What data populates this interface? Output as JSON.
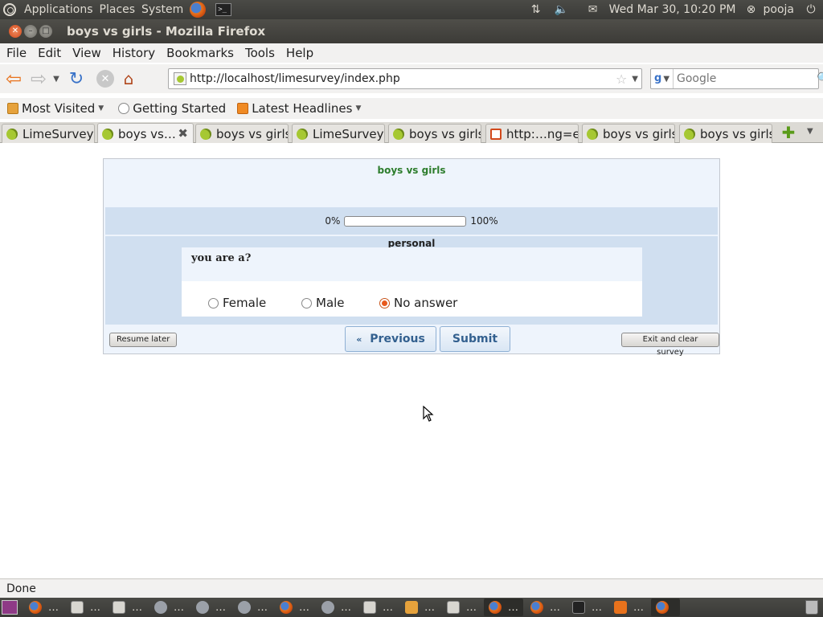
{
  "top_panel": {
    "applications": "Applications",
    "places": "Places",
    "system": "System",
    "datetime": "Wed Mar 30, 10:20 PM",
    "user": "pooja"
  },
  "window": {
    "title": "boys vs girls - Mozilla Firefox"
  },
  "menu": {
    "items": [
      "File",
      "Edit",
      "View",
      "History",
      "Bookmarks",
      "Tools",
      "Help"
    ]
  },
  "navbar": {
    "url": "http://localhost/limesurvey/index.php",
    "search_placeholder": "Google"
  },
  "bookmarks": {
    "items": [
      "Most Visited",
      "Getting Started",
      "Latest Headlines"
    ]
  },
  "tabs": [
    {
      "label": "LimeSurvey"
    },
    {
      "label": "boys vs…",
      "active": true
    },
    {
      "label": "boys vs girls"
    },
    {
      "label": "LimeSurvey"
    },
    {
      "label": "boys vs girls"
    },
    {
      "label": "http:…ng=en"
    },
    {
      "label": "boys vs girls"
    },
    {
      "label": "boys vs girls"
    }
  ],
  "survey": {
    "title": "boys vs girls",
    "progress_start": "0%",
    "progress_end": "100%",
    "progress_value": 0,
    "group_name": "personal",
    "question": "you are a?",
    "answers": [
      "Female",
      "Male",
      "No answer"
    ],
    "selected_answer": "No answer",
    "resume_later": "Resume later",
    "previous": "Previous",
    "previous_icon": "«",
    "submit": "Submit",
    "exit_clear": "Exit and clear survey"
  },
  "status": {
    "text": "Done"
  },
  "taskbar": {
    "items": [
      "…",
      "…",
      "…",
      "…",
      "…",
      "…",
      "…",
      "…",
      "…",
      "…",
      "…",
      "…",
      "…",
      "…",
      "…",
      "…"
    ]
  },
  "colors": {
    "survey_title": "#2d7d2d",
    "survey_bg": "#eef4fc",
    "group_bg": "#d0dff0",
    "accent_orange": "#e8721c"
  }
}
